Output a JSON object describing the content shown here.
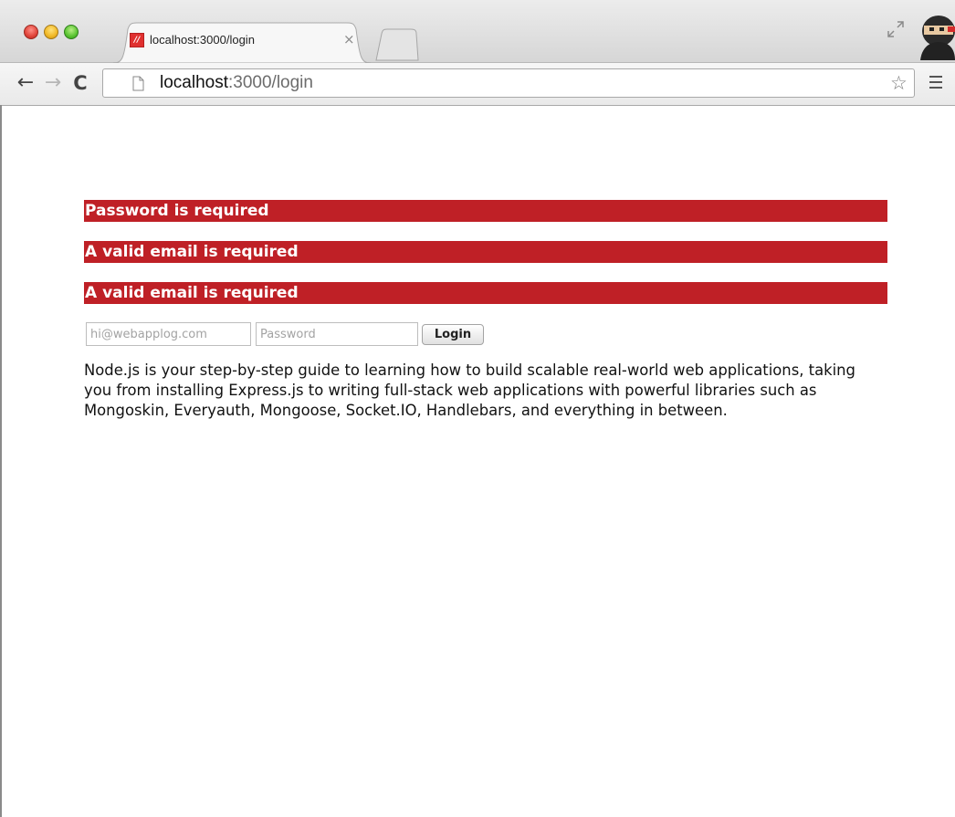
{
  "browser": {
    "tab_title": "localhost:3000/login",
    "tab_close": "×",
    "favicon_text": "//",
    "url_host": "localhost",
    "url_path": ":3000/login",
    "back_glyph": "←",
    "forward_glyph": "→",
    "reload_glyph": "C",
    "star_glyph": "☆"
  },
  "errors": [
    "Password is required",
    "A valid email is required",
    "A valid email is required"
  ],
  "form": {
    "email_placeholder": "hi@webapplog.com",
    "password_placeholder": "Password",
    "login_label": "Login"
  },
  "description": "Node.js is your step-by-step guide to learning how to build scalable real-world web applications, taking you from installing Express.js to writing full-stack web applications with powerful libraries such as Mongoskin, Everyauth, Mongoose, Socket.IO, Handlebars, and everything in between.",
  "colors": {
    "error_background": "#bf2026",
    "error_text": "#ffffff"
  }
}
